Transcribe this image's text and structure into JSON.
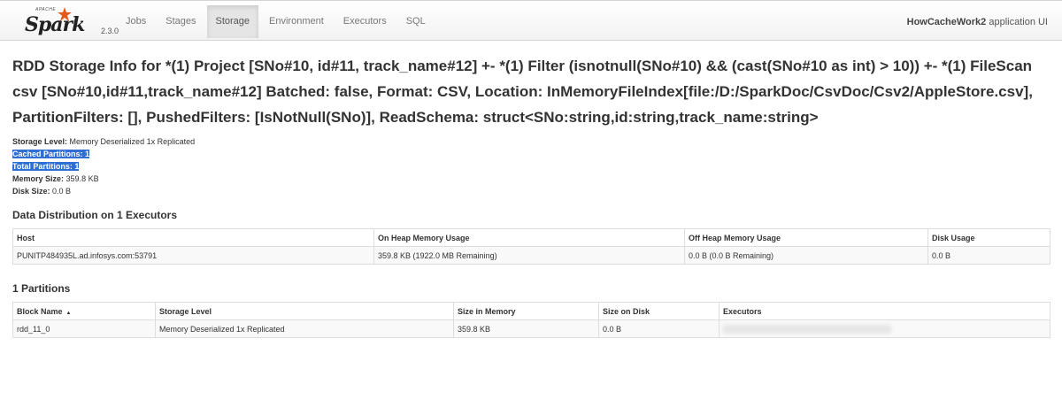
{
  "navbar": {
    "logo_top": "APACHE",
    "logo_word": "Spark",
    "version": "2.3.0",
    "tabs": [
      {
        "label": "Jobs",
        "active": false
      },
      {
        "label": "Stages",
        "active": false
      },
      {
        "label": "Storage",
        "active": true
      },
      {
        "label": "Environment",
        "active": false
      },
      {
        "label": "Executors",
        "active": false
      },
      {
        "label": "SQL",
        "active": false
      }
    ],
    "app_name": "HowCacheWork2",
    "app_suffix": " application UI"
  },
  "page": {
    "title": "RDD Storage Info for *(1) Project [SNo#10, id#11, track_name#12] +- *(1) Filter (isnotnull(SNo#10) && (cast(SNo#10 as int) > 10)) +- *(1) FileScan csv [SNo#10,id#11,track_name#12] Batched: false, Format: CSV, Location: InMemoryFileIndex[file:/D:/SparkDoc/CsvDoc/Csv2/AppleStore.csv], PartitionFilters: [], PushedFilters: [IsNotNull(SNo)], ReadSchema: struct<SNo:string,id:string,track_name:string>"
  },
  "summary": {
    "storage_level_label": "Storage Level:",
    "storage_level_value": "Memory Deserialized 1x Replicated",
    "cached_partitions_label": "Cached Partitions:",
    "cached_partitions_value": "1",
    "total_partitions_label": "Total Partitions:",
    "total_partitions_value": "1",
    "memory_size_label": "Memory Size:",
    "memory_size_value": "359.8 KB",
    "disk_size_label": "Disk Size:",
    "disk_size_value": "0.0 B"
  },
  "distribution": {
    "heading": "Data Distribution on 1 Executors",
    "columns": [
      "Host",
      "On Heap Memory Usage",
      "Off Heap Memory Usage",
      "Disk Usage"
    ],
    "rows": [
      [
        "PUNITP484935L.ad.infosys.com:53791",
        "359.8 KB (1922.0 MB Remaining)",
        "0.0 B (0.0 B Remaining)",
        "0.0 B"
      ]
    ]
  },
  "partitions": {
    "heading": "1 Partitions",
    "columns": [
      "Block Name",
      "Storage Level",
      "Size in Memory",
      "Size on Disk",
      "Executors"
    ],
    "sort_indicator": "▲",
    "rows": [
      [
        "rdd_11_0",
        "Memory Deserialized 1x Replicated",
        "359.8 KB",
        "0.0 B",
        ""
      ]
    ]
  }
}
